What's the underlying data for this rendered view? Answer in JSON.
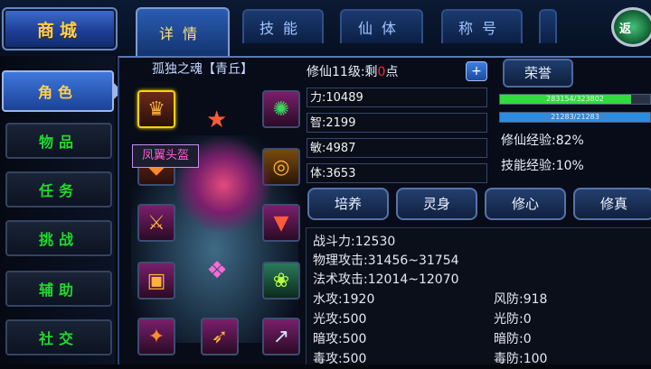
{
  "top": {
    "shop_label": "商城",
    "tabs": [
      {
        "label": "详情",
        "active": true
      },
      {
        "label": "技能",
        "active": false
      },
      {
        "label": "仙体",
        "active": false
      },
      {
        "label": "称号",
        "active": false
      }
    ],
    "close_label": "返"
  },
  "left_nav": [
    {
      "label": "角色",
      "active": true
    },
    {
      "label": "物品",
      "active": false
    },
    {
      "label": "任务",
      "active": false
    },
    {
      "label": "挑战",
      "active": false
    },
    {
      "label": "辅助",
      "active": false
    },
    {
      "label": "社交",
      "active": false
    }
  ],
  "character": {
    "title": "孤独之魂【青丘】",
    "tooltip": "凤翼头盔",
    "equipment_icons": [
      "helmet-icon",
      "amulet-icon",
      "ring-icon",
      "shoulder-icon",
      "weapon-icon",
      "cape-icon",
      "armor-icon",
      "belt-icon",
      "boots-icon",
      "bow-icon",
      "bracer-icon",
      "spear-icon"
    ]
  },
  "level": {
    "prefix": "修仙11级:剩",
    "points": "0",
    "suffix": "点",
    "plus_label": "+",
    "honor_label": "荣誉"
  },
  "stats": [
    "力:10489",
    "智:2199",
    "敏:4987",
    "体:3653"
  ],
  "bars": [
    {
      "text": "283154/323802",
      "fraction": 0.874,
      "color": "#2fdc3c"
    },
    {
      "text": "21283/21283",
      "fraction": 1.0,
      "color": "#2d8be0"
    }
  ],
  "experience": {
    "cultivation": "修仙经验:82%",
    "skill": "技能经验:10%"
  },
  "action_buttons": [
    "培养",
    "灵身",
    "修心",
    "修真"
  ],
  "details": {
    "power": "战斗力:12530",
    "physical_attack": "物理攻击:31456~31754",
    "magic_attack": "法术攻击:12014~12070",
    "left": [
      "水攻:1920",
      "光攻:500",
      "暗攻:500",
      "毒攻:500"
    ],
    "right": [
      "风防:918",
      "光防:0",
      "暗防:0",
      "毒防:100"
    ]
  }
}
